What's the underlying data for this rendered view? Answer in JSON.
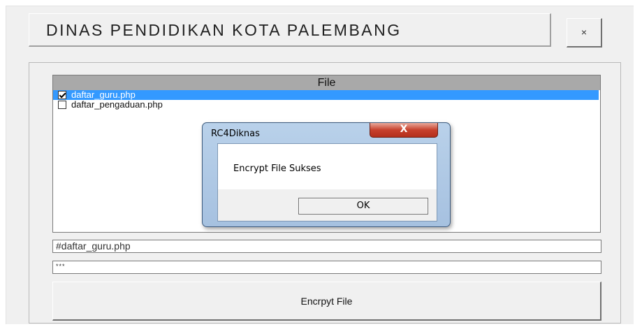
{
  "header": {
    "title": "DINAS PENDIDIKAN KOTA PALEMBANG",
    "close_label": "×"
  },
  "file_list": {
    "column_header": "File",
    "items": [
      {
        "label": "daftar_guru.php",
        "checked": true,
        "selected": true
      },
      {
        "label": "daftar_pengaduan.php",
        "checked": false,
        "selected": false
      }
    ]
  },
  "path_field": {
    "value": "#daftar_guru.php"
  },
  "password_field": {
    "value": "***"
  },
  "encrypt_button": {
    "label": "Encrpyt File"
  },
  "dialog": {
    "title": "RC4Diknas",
    "close_label": "X",
    "message": "Encrypt File Sukses",
    "ok_label": "OK"
  },
  "colors": {
    "selection": "#3399ff",
    "dialog_frame": "#b9d1ea",
    "close_red": "#c7402c"
  }
}
